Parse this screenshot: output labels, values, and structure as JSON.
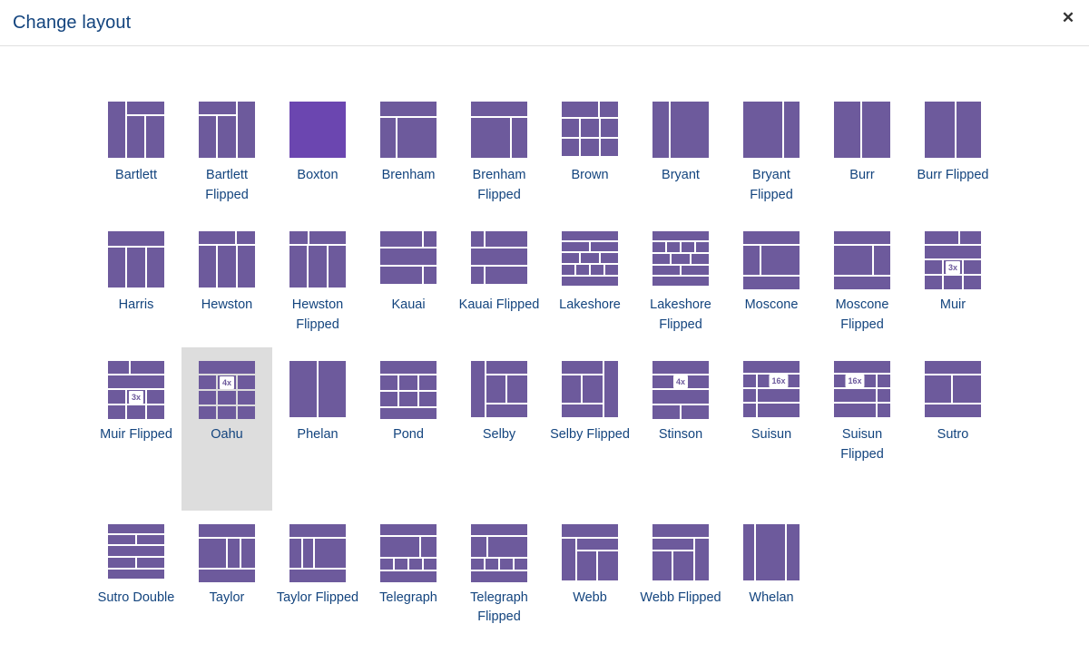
{
  "header": {
    "title": "Change layout",
    "close_label": "✕",
    "close_icon": "close-icon"
  },
  "colors": {
    "tile": "#6d5a9c",
    "tile_selected": "#6b46b0",
    "label_text": "#13447e",
    "hover_background": "#dddddd",
    "badge_text": "#6d5a9c"
  },
  "layouts": [
    {
      "name": "Bartlett",
      "state": "normal"
    },
    {
      "name": "Bartlett Flipped",
      "state": "normal"
    },
    {
      "name": "Boxton",
      "state": "selected"
    },
    {
      "name": "Brenham",
      "state": "normal"
    },
    {
      "name": "Brenham Flipped",
      "state": "normal"
    },
    {
      "name": "Brown",
      "state": "normal"
    },
    {
      "name": "Bryant",
      "state": "normal"
    },
    {
      "name": "Bryant Flipped",
      "state": "normal"
    },
    {
      "name": "Burr",
      "state": "normal"
    },
    {
      "name": "Burr Flipped",
      "state": "normal"
    },
    {
      "name": "Harris",
      "state": "normal"
    },
    {
      "name": "Hewston",
      "state": "normal"
    },
    {
      "name": "Hewston Flipped",
      "state": "normal"
    },
    {
      "name": "Kauai",
      "state": "normal"
    },
    {
      "name": "Kauai Flipped",
      "state": "normal"
    },
    {
      "name": "Lakeshore",
      "state": "normal"
    },
    {
      "name": "Lakeshore Flipped",
      "state": "normal"
    },
    {
      "name": "Moscone",
      "state": "normal"
    },
    {
      "name": "Moscone Flipped",
      "state": "normal"
    },
    {
      "name": "Muir",
      "state": "normal",
      "badge": "3x"
    },
    {
      "name": "Muir Flipped",
      "state": "normal",
      "badge": "3x"
    },
    {
      "name": "Oahu",
      "state": "hovered",
      "badge": "4x"
    },
    {
      "name": "Phelan",
      "state": "normal"
    },
    {
      "name": "Pond",
      "state": "normal"
    },
    {
      "name": "Selby",
      "state": "normal"
    },
    {
      "name": "Selby Flipped",
      "state": "normal"
    },
    {
      "name": "Stinson",
      "state": "normal",
      "badge": "4x"
    },
    {
      "name": "Suisun",
      "state": "normal",
      "badge": "16x"
    },
    {
      "name": "Suisun Flipped",
      "state": "normal",
      "badge": "16x"
    },
    {
      "name": "Sutro",
      "state": "normal"
    },
    {
      "name": "Sutro Double",
      "state": "normal"
    },
    {
      "name": "Taylor",
      "state": "normal"
    },
    {
      "name": "Taylor Flipped",
      "state": "normal"
    },
    {
      "name": "Telegraph",
      "state": "normal"
    },
    {
      "name": "Telegraph Flipped",
      "state": "normal"
    },
    {
      "name": "Webb",
      "state": "normal"
    },
    {
      "name": "Webb Flipped",
      "state": "normal"
    },
    {
      "name": "Whelan",
      "state": "normal"
    }
  ]
}
